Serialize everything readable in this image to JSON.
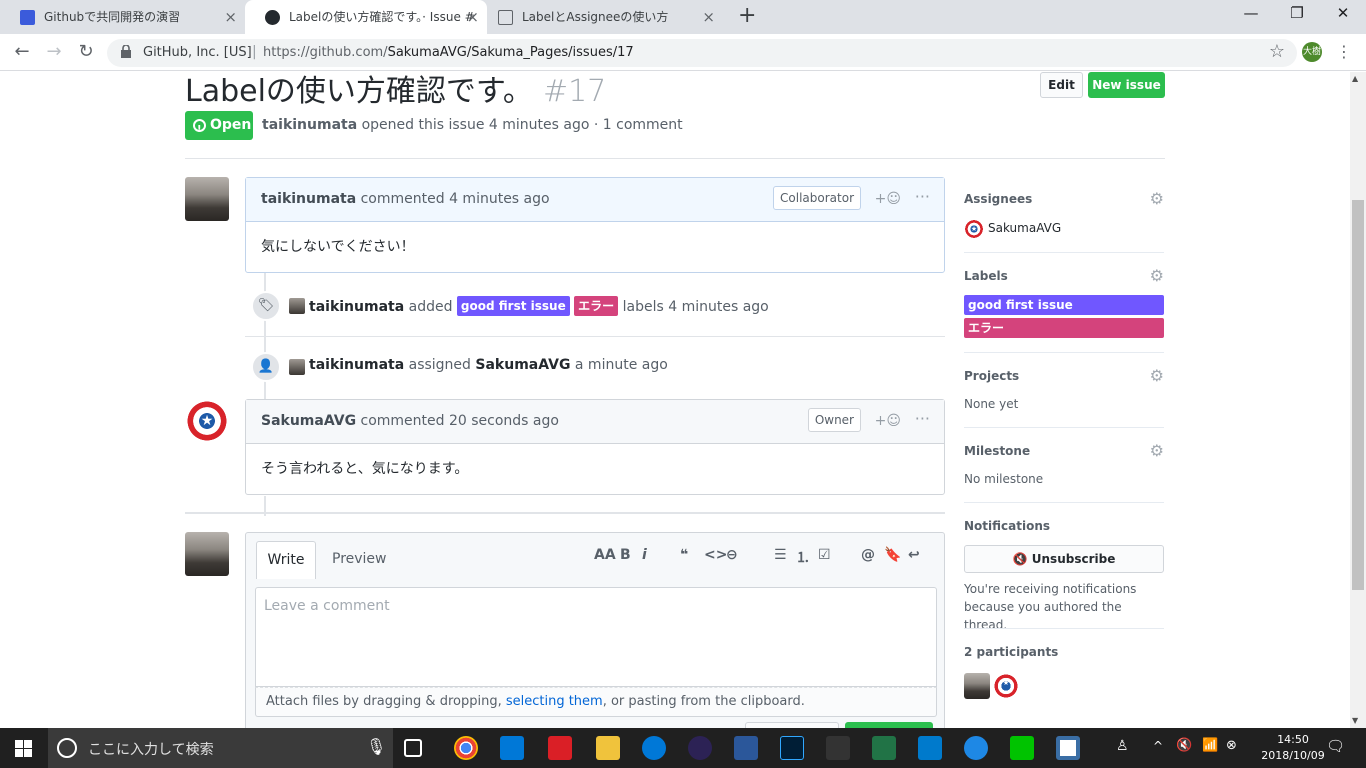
{
  "browser": {
    "tabs": [
      {
        "title": "Githubで共同開発の演習",
        "close": "×"
      },
      {
        "title": "Labelの使い方確認です。· Issue #",
        "close": "×"
      },
      {
        "title": "LabelとAssigneeの使い方",
        "close": "×"
      }
    ],
    "new_tab": "+",
    "window": {
      "minimize": "—",
      "maximize": "❐",
      "close": "✕"
    },
    "nav": {
      "back": "←",
      "forward": "→",
      "reload": "↻"
    },
    "site_identity": "GitHub, Inc. [US]",
    "url_prefix": "https://github.com/",
    "url_path": "SakumaAVG/Sakuma_Pages/issues/17",
    "profile_initials": "大樹",
    "bookmark": "☆",
    "menu": "⋮"
  },
  "issue": {
    "title": "Labelの使い方確認です。",
    "number": "#17",
    "edit_label": "Edit",
    "new_issue_label": "New issue",
    "state": "Open",
    "author": "taikinumata",
    "meta_text": "opened this issue 4 minutes ago · 1 comment"
  },
  "comments": [
    {
      "author": "taikinumata",
      "when": "commented 4 minutes ago",
      "badge": "Collaborator",
      "react": "+☺",
      "more": "···",
      "body": "気にしないでください！"
    },
    {
      "author": "SakumaAVG",
      "when": "commented 20 seconds ago",
      "badge": "Owner",
      "react": "+☺",
      "more": "···",
      "body": "そう言われると、気になります。"
    }
  ],
  "events": [
    {
      "icon": "🏷",
      "actor": "taikinumata",
      "verb": "added",
      "labels": [
        "good first issue",
        "エラー"
      ],
      "suffix": "labels 4 minutes ago"
    },
    {
      "icon": "👤",
      "actor": "taikinumata",
      "verb": "assigned",
      "target": "SakumaAVG",
      "suffix": "a minute ago"
    }
  ],
  "composer": {
    "write_tab": "Write",
    "preview_tab": "Preview",
    "tools": [
      "AA",
      "B",
      "i",
      "❝",
      "<>",
      "⊖",
      "☰",
      "⒈",
      "☑",
      "@",
      "🔖",
      "↩"
    ],
    "placeholder": "Leave a comment",
    "attach_pre": "Attach files by dragging & dropping, ",
    "attach_link": "selecting them",
    "attach_post": ", or pasting from the clipboard."
  },
  "sidebar": {
    "assignees_heading": "Assignees",
    "assignee": "SakumaAVG",
    "labels_heading": "Labels",
    "labels": [
      {
        "name": "good first issue",
        "color": "#7057ff"
      },
      {
        "name": "エラー",
        "color": "#d4437c"
      }
    ],
    "projects_heading": "Projects",
    "projects_value": "None yet",
    "milestone_heading": "Milestone",
    "milestone_value": "No milestone",
    "notifications_heading": "Notifications",
    "unsubscribe_label": "🔇 Unsubscribe",
    "notifications_reason": "You're receiving notifications because you authored the thread.",
    "participants_heading": "2 participants",
    "gear": "⚙"
  },
  "taskbar": {
    "search_placeholder": "ここに入力して検索",
    "time": "14:50",
    "date": "2018/10/09"
  },
  "colors": {
    "green": "#2cbe4e",
    "label_good_first_issue": "#7057ff",
    "label_error": "#d4437c"
  }
}
